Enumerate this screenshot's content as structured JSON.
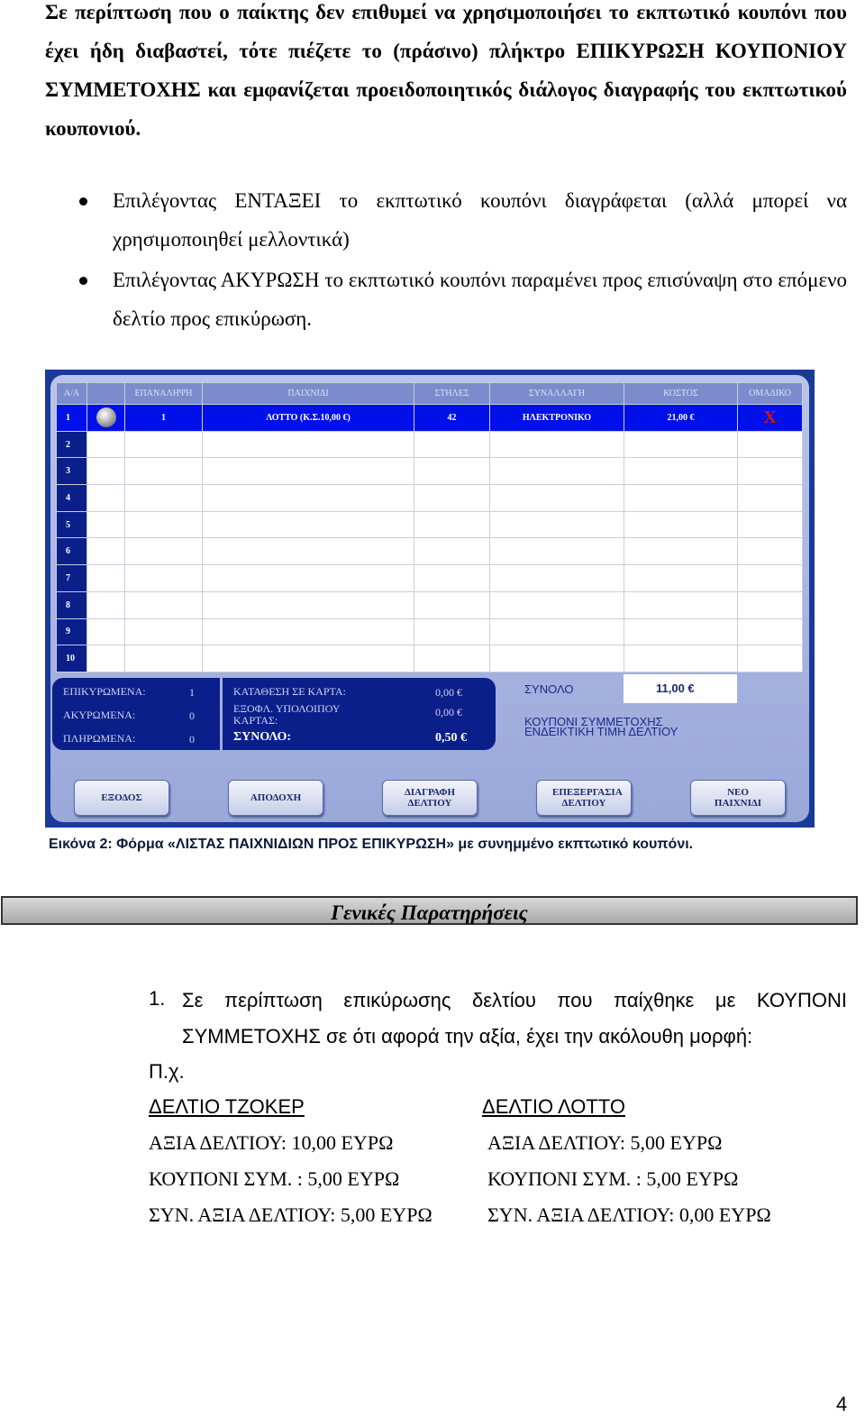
{
  "intro": "Σε περίπτωση που ο παίκτης δεν επιθυμεί να χρησιμοποιήσει το εκπτωτικό κουπόνι που έχει ήδη διαβαστεί, τότε πιέζετε το (πράσινο) πλήκτρο ΕΠΙΚΥΡΩΣΗ ΚΟΥΠΟΝΙΟΥ ΣΥΜΜΕΤΟΧΗΣ και εμφανίζεται προειδοποιητικός διάλογος διαγραφής του εκπτωτικού κουπονιού.",
  "bullets": [
    "Επιλέγοντας ΕΝΤΑΞΕΙ το εκπτωτικό κουπόνι διαγράφεται (αλλά μπορεί να χρησιμοποιηθεί μελλοντικά)",
    "Επιλέγοντας ΑΚΥΡΩΣΗ το εκπτωτικό κουπόνι παραμένει προς επισύναψη στο επόμενο δελτίο προς επικύρωση."
  ],
  "screen": {
    "columns": [
      "Α/Α",
      "",
      "ΕΠΑΝΑΛΗΨΗ",
      "ΠΑΙΧΝΙΔΙ",
      "ΣΤΗΛΕΣ",
      "ΣΥΝΑΛΛΑΓΗ",
      "ΚΟΣΤΟΣ",
      "ΟΜΑΔΙΚΟ"
    ],
    "row1": {
      "num": "1",
      "repeat": "1",
      "game": "ΛΟΤΤΟ   (Κ.Σ.10,00 €)",
      "columns": "42",
      "transaction": "ΗΛΕΚΤΡΟΝΙΚΟ",
      "cost": "21,00 €",
      "group": "X"
    },
    "row_numbers": [
      "2",
      "3",
      "4",
      "5",
      "6",
      "7",
      "8",
      "9",
      "10"
    ],
    "stats": [
      {
        "label": "ΕΠΙΚΥΡΩΜΕΝΑ:",
        "value": "1"
      },
      {
        "label": "ΑΚΥΡΩΜΕΝΑ:",
        "value": "0"
      },
      {
        "label": "ΠΛΗΡΩΜΕΝΑ:",
        "value": "0"
      }
    ],
    "card": [
      {
        "label": "ΚΑΤΑΘΕΣΗ ΣΕ ΚΑΡΤΑ:",
        "value": "0,00 €"
      },
      {
        "label": "ΕΞΟΦΛ. ΥΠΟΛΟΙΠΟΥ ΚΑΡΤΑΣ:",
        "value": "0,00 €"
      },
      {
        "label": "ΣΥΝΟΛΟ:",
        "value": "0,50 €"
      }
    ],
    "total_label": "ΣΥΝΟΛΟ",
    "total_value": "11,00 €",
    "coupon_line1": "ΚΟΥΠΟΝΙ ΣΥΜΜΕΤΟΧΗΣ",
    "coupon_line2": "ΕΝΔΕΙΚΤΙΚΗ ΤΙΜΗ ΔΕΛΤΙΟΥ",
    "buttons": [
      "ΕΞΟΔΟΣ",
      "ΑΠΟΔΟΧΗ",
      "ΔΙΑΓΡΑΦΗ ΔΕΛΤΙΟΥ",
      "ΕΠΕΞΕΡΓΑΣΙΑ ΔΕΛΤΙΟΥ",
      "ΝΕΟ ΠΑΙΧΝΙΔΙ"
    ],
    "accent": "#0010e8"
  },
  "caption": "Εικόνα 2: Φόρμα «ΛΙΣΤΑΣ ΠΑΙΧΝΙΔΙΩΝ ΠΡΟΣ ΕΠΙΚΥΡΩΣΗ» με συνημμένο εκπτωτικό κουπόνι.",
  "section_title": "Γενικές Παρατηρήσεις",
  "item1_num": "1.",
  "item1": "Σε περίπτωση επικύρωσης δελτίου που παίχθηκε με ΚΟΥΠΟΝΙ ΣΥΜΜΕΤΟΧΗΣ σε ότι αφορά την αξία, έχει την ακόλουθη μορφή:",
  "example": "Π.χ.",
  "left": {
    "title": "ΔΕΛΤΙΟ ΤΖΟΚΕΡ",
    "lines": [
      "ΑΞΙΑ ΔΕΛΤΙΟΥ: 10,00 ΕΥΡΩ",
      "ΚΟΥΠΟΝΙ ΣΥΜ. : 5,00 ΕΥΡΩ",
      "ΣΥΝ. ΑΞΙΑ ΔΕΛΤΙΟΥ: 5,00 ΕΥΡΩ"
    ]
  },
  "right": {
    "title": "ΔΕΛΤΙΟ ΛΟΤΤΟ",
    "lines": [
      "ΑΞΙΑ ΔΕΛΤΙΟΥ: 5,00 ΕΥΡΩ",
      "ΚΟΥΠΟΝΙ ΣΥΜ. : 5,00 ΕΥΡΩ",
      "ΣΥΝ. ΑΞΙΑ ΔΕΛΤΙΟΥ: 0,00 ΕΥΡΩ"
    ]
  },
  "page_number": "4"
}
